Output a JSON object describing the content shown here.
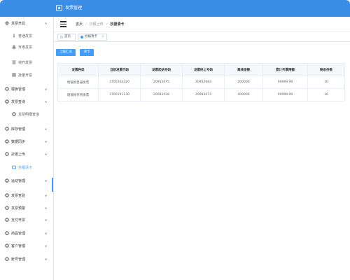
{
  "app": {
    "title": "发票管理"
  },
  "sidebar": {
    "items": [
      {
        "label": "发票开具",
        "icon": "gear-icon",
        "chevron": "up"
      },
      {
        "label": "普通发票",
        "icon": "info-icon",
        "sub": true
      },
      {
        "label": "专用发票",
        "icon": "stamp-icon",
        "sub": true
      },
      {
        "label": "待开发票",
        "icon": "list-icon",
        "sub": true
      },
      {
        "label": "批量开票",
        "icon": "grid-icon",
        "sub": true
      },
      {
        "label": "模板管理",
        "icon": "template-icon",
        "chevron": "down"
      },
      {
        "label": "发票查询",
        "icon": "search-icon",
        "chevron": "up"
      },
      {
        "label": "发票明细查询",
        "icon": "detail-icon",
        "sub": true
      },
      {
        "label": "库存管理",
        "icon": "inventory-icon",
        "chevron": "down"
      },
      {
        "label": "数据同步",
        "icon": "sync-icon",
        "chevron": "down"
      },
      {
        "label": "抄报上传",
        "icon": "upload-icon",
        "chevron": "up"
      },
      {
        "label": "抄报清卡",
        "icon": "card-icon",
        "sub": true,
        "active": true
      },
      {
        "label": "运动管理",
        "icon": "ops-icon",
        "chevron": "down"
      },
      {
        "label": "发票查验",
        "icon": "verify-icon",
        "chevron": "down"
      },
      {
        "label": "发票预警",
        "icon": "alert-icon",
        "chevron": "down"
      },
      {
        "label": "支付开票",
        "icon": "pay-icon",
        "chevron": "down"
      },
      {
        "label": "商品管理",
        "icon": "goods-icon",
        "chevron": "down"
      },
      {
        "label": "客户管理",
        "icon": "customer-icon",
        "chevron": "down"
      },
      {
        "label": "账号管理",
        "icon": "account-icon",
        "chevron": "down"
      }
    ]
  },
  "header": {
    "breadcrumb": [
      "首页",
      "抄报上传",
      "抄报清卡"
    ]
  },
  "tags": [
    {
      "label": "首页",
      "active": false
    },
    {
      "label": "抄报清卡",
      "active": true,
      "closable": "×"
    }
  ],
  "toolbar": {
    "upload_label": "上报汇总",
    "clear_label": "清卡"
  },
  "table": {
    "columns": [
      "发票种类",
      "当前发票代码",
      "发票起始号码",
      "发票终止号码",
      "离线金额",
      "累计开票限额",
      "剩余份数"
    ],
    "rows": [
      [
        "增值税普通发票",
        "3700163320",
        "20952675",
        "20952683",
        "200000",
        "99999.99",
        "10"
      ],
      [
        "增值税专用发票",
        "3700191130",
        "20083438",
        "20083473",
        "400000",
        "99999.99",
        "36"
      ]
    ]
  },
  "colors": {
    "primary": "#409eff",
    "topbar": "#3a8ee6"
  }
}
